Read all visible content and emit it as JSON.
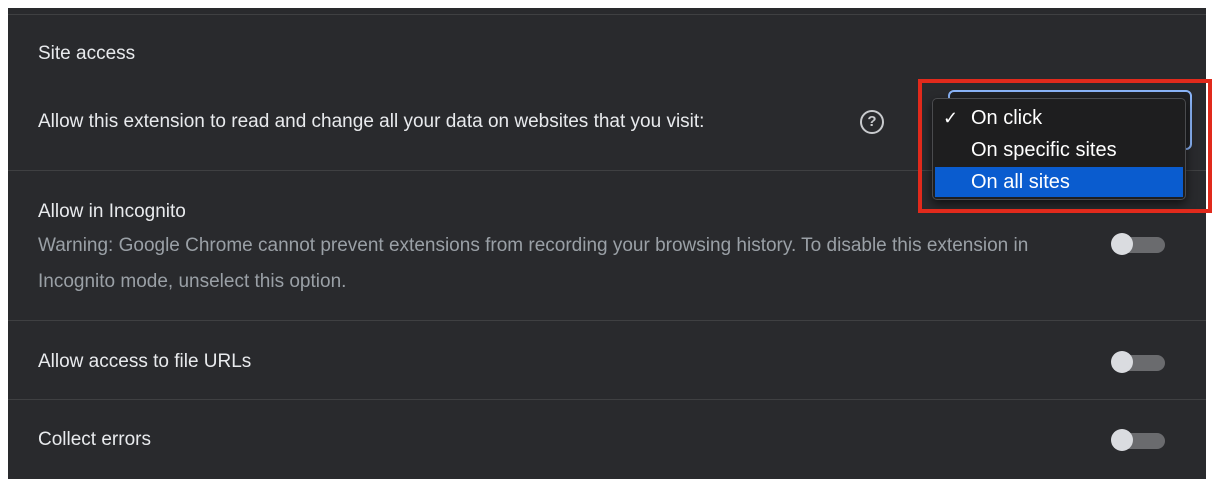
{
  "site_access": {
    "heading": "Site access",
    "description": "Allow this extension to read and change all your data on websites that you visit:",
    "help_icon": "help-circle-icon",
    "dropdown": {
      "selected": "On click",
      "options": [
        "On click",
        "On specific sites",
        "On all sites"
      ],
      "highlighted": "On all sites"
    }
  },
  "incognito": {
    "title": "Allow in Incognito",
    "warning": "Warning: Google Chrome cannot prevent extensions from recording your browsing history. To disable this extension in Incognito mode, unselect this option.",
    "enabled": false
  },
  "file_urls": {
    "title": "Allow access to file URLs",
    "enabled": false
  },
  "collect_errors": {
    "title": "Collect errors",
    "enabled": false
  },
  "colors": {
    "background": "#292a2d",
    "accent": "#0a5ccf",
    "annotation": "#e12a1c"
  },
  "check_glyph": "✓"
}
